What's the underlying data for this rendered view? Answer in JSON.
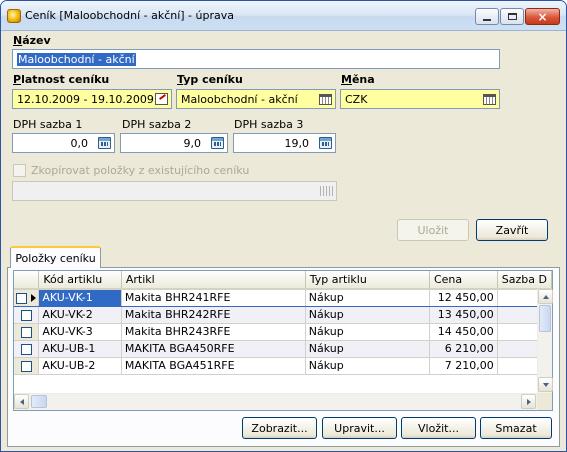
{
  "window": {
    "title": "Ceník [Maloobchodní - akční] - úprava",
    "minimize_label": "_",
    "maximize_label": "□",
    "close_label": "×"
  },
  "form": {
    "name_label_pre": "N",
    "name_label_rest": "ázev",
    "name_value": "Maloobchodní - akční",
    "validity_label_pre": "P",
    "validity_label_rest": "latnost ceníku",
    "validity_value": "12.10.2009 - 19.10.2009",
    "type_label_pre": "T",
    "type_label_rest": "yp ceníku",
    "type_value": "Maloobchodní - akční",
    "currency_label_pre": "M",
    "currency_label_rest": "ěna",
    "currency_value": "CZK",
    "vat1_label": "DPH sazba 1",
    "vat1_value": "0,0",
    "vat2_label": "DPH sazba 2",
    "vat2_value": "9,0",
    "vat3_label": "DPH sazba 3",
    "vat3_value": "19,0",
    "copy_items_label": "Zkopírovat položky z existujícího ceníku",
    "copy_source_value": ""
  },
  "buttons": {
    "save": "Uložit",
    "close": "Zavřít",
    "show": "Zobrazit...",
    "edit": "Upravit...",
    "insert": "Vložit...",
    "delete": "Smazat"
  },
  "tabs": [
    {
      "label": "Položky ceníku"
    }
  ],
  "grid": {
    "columns": [
      "Kód artiklu",
      "Artikl",
      "Typ artiklu",
      "Cena",
      "Sazba D"
    ],
    "rows": [
      {
        "code": "AKU-VK-1",
        "article": "Makita BHR241RFE",
        "type": "Nákup",
        "price": "12 450,00"
      },
      {
        "code": "AKU-VK-2",
        "article": "Makita BHR242RFE",
        "type": "Nákup",
        "price": "13 450,00"
      },
      {
        "code": "AKU-VK-3",
        "article": "Makita BHR243RFE",
        "type": "Nákup",
        "price": "14 450,00"
      },
      {
        "code": "AKU-UB-1",
        "article": "MAKITA BGA450RFE",
        "type": "Nákup",
        "price": "6 210,00"
      },
      {
        "code": "AKU-UB-2",
        "article": "MAKITA BGA451RFE",
        "type": "Nákup",
        "price": "7 210,00"
      }
    ]
  },
  "colors": {
    "window_border": "#2b55a3",
    "dialog_bg": "#ece9d8",
    "required_field_bg": "#ffffa0",
    "selection": "#316ac5"
  }
}
